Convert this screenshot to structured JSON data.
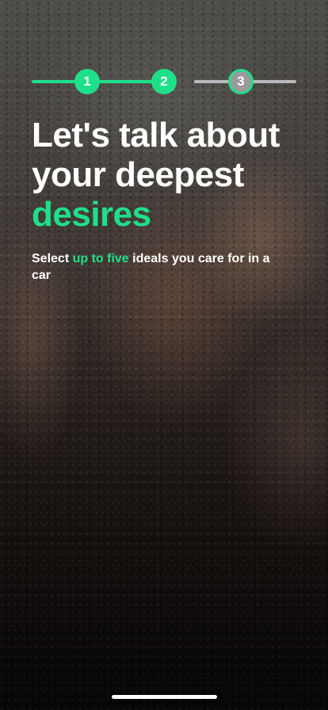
{
  "stepper": {
    "steps": [
      {
        "label": "1",
        "state": "completed"
      },
      {
        "label": "2",
        "state": "completed"
      },
      {
        "label": "3",
        "state": "current"
      }
    ],
    "colors": {
      "active": "#1fe08a",
      "inactive": "#b9b9bc"
    }
  },
  "headline": {
    "line1": "Let's talk about",
    "line2": "your deepest",
    "accent": "desires"
  },
  "subtitle": {
    "prefix": "Select ",
    "highlight": "up to five",
    "suffix": " ideals you care for in a car"
  },
  "background": {
    "description": "blurred photo of a hand pressed against a wet glass shower door"
  }
}
